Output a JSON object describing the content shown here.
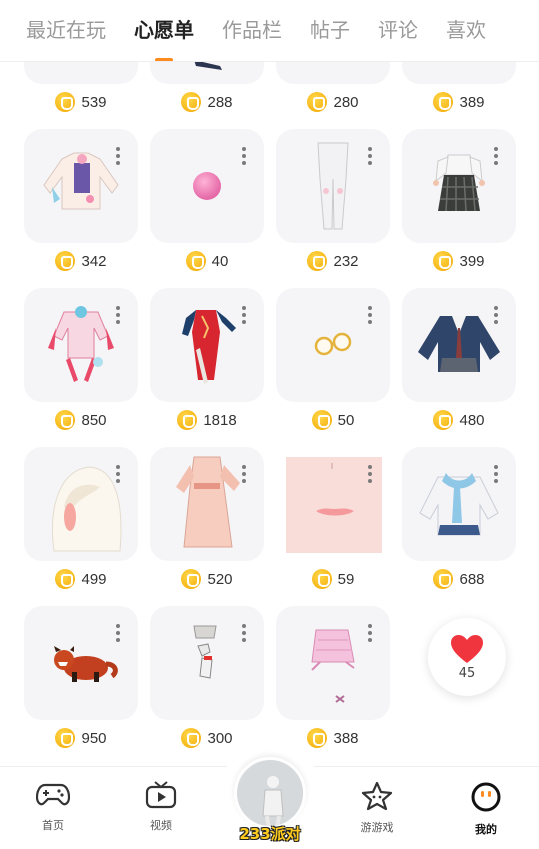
{
  "tabs": [
    {
      "label": "最近在玩",
      "active": false
    },
    {
      "label": "心愿单",
      "active": true
    },
    {
      "label": "作品栏",
      "active": false
    },
    {
      "label": "帖子",
      "active": false
    },
    {
      "label": "评论",
      "active": false
    },
    {
      "label": "喜欢",
      "active": false
    }
  ],
  "items": [
    {
      "price": "539",
      "icon": "outfit-icon"
    },
    {
      "price": "288",
      "icon": "outfit-icon"
    },
    {
      "price": "280",
      "icon": "outfit-icon"
    },
    {
      "price": "389",
      "icon": "outfit-icon"
    },
    {
      "price": "342",
      "icon": "pastel-jacket-icon"
    },
    {
      "price": "40",
      "icon": "pink-ball-icon"
    },
    {
      "price": "232",
      "icon": "white-leggings-icon"
    },
    {
      "price": "399",
      "icon": "plaid-dress-icon"
    },
    {
      "price": "850",
      "icon": "pink-outfit-icon"
    },
    {
      "price": "1818",
      "icon": "red-qipao-icon"
    },
    {
      "price": "50",
      "icon": "round-glasses-icon"
    },
    {
      "price": "480",
      "icon": "navy-uniform-icon"
    },
    {
      "price": "499",
      "icon": "white-hair-icon"
    },
    {
      "price": "520",
      "icon": "pink-hanfu-icon"
    },
    {
      "price": "59",
      "icon": "lips-makeup-icon"
    },
    {
      "price": "688",
      "icon": "blue-jacket-icon"
    },
    {
      "price": "950",
      "icon": "red-panda-icon"
    },
    {
      "price": "300",
      "icon": "bandage-set-icon"
    },
    {
      "price": "388",
      "icon": "pink-skirt-icon"
    }
  ],
  "likes": {
    "count": "45"
  },
  "bottom_nav": [
    {
      "label": "首页",
      "icon": "gamepad-icon",
      "active": false
    },
    {
      "label": "视频",
      "icon": "tv-icon",
      "active": false
    },
    {
      "label": "233派对",
      "icon": "avatar-icon",
      "active": false
    },
    {
      "label": "游游戏",
      "icon": "star-icon",
      "active": false
    },
    {
      "label": "我的",
      "icon": "smile-icon",
      "active": true
    }
  ],
  "colors": {
    "accent": "#ff8a1f",
    "coin": "#f5b400",
    "heart": "#f0353f"
  }
}
